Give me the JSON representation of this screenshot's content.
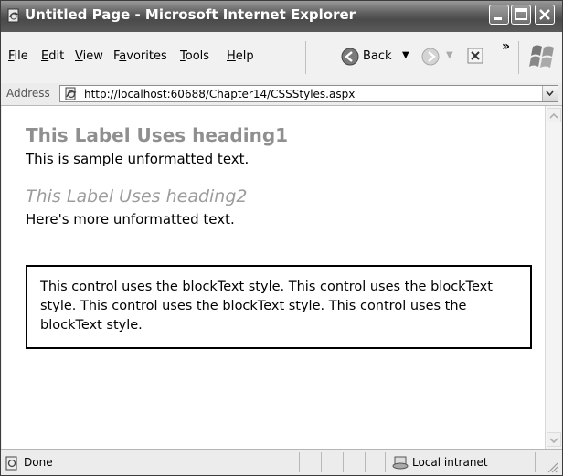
{
  "window": {
    "title": "Untitled Page - Microsoft Internet Explorer"
  },
  "menu": {
    "items": [
      "File",
      "Edit",
      "View",
      "Favorites",
      "Tools",
      "Help"
    ],
    "underlined": [
      "F",
      "E",
      "V",
      "a",
      "T",
      "H"
    ]
  },
  "toolbar": {
    "back_label": "Back",
    "chevron": "»"
  },
  "address": {
    "label": "Address",
    "url": "http://localhost:60688/Chapter14/CSSStyles.aspx"
  },
  "page": {
    "heading1": "This Label Uses heading1",
    "text1": "This is sample unformatted text.",
    "heading2": "This Label Uses heading2",
    "text2": "Here's more unformatted text.",
    "block_text": "This control uses the blockText style. This control uses the blockText style. This control uses the blockText style. This control uses the blockText style."
  },
  "status": {
    "text": "Done",
    "zone": "Local intranet"
  }
}
